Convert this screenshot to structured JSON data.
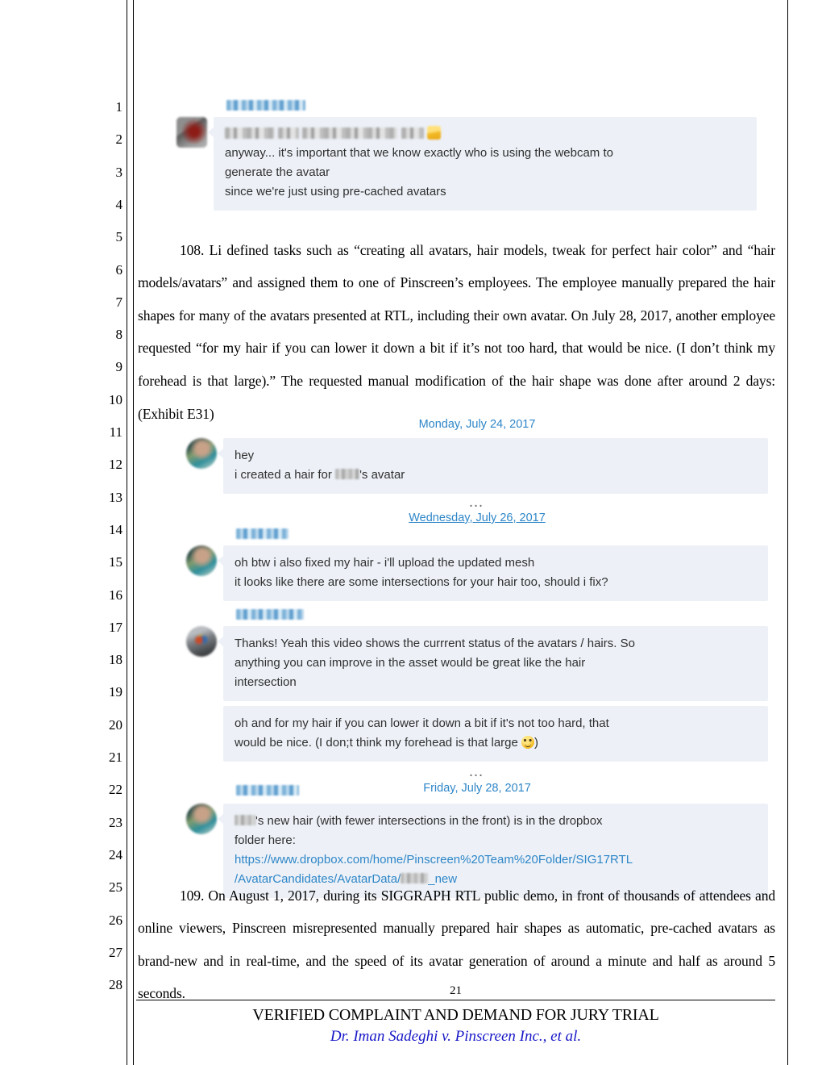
{
  "document": {
    "line_numbers": [
      "1",
      "2",
      "3",
      "4",
      "5",
      "6",
      "7",
      "8",
      "9",
      "10",
      "11",
      "12",
      "13",
      "14",
      "15",
      "16",
      "17",
      "18",
      "19",
      "20",
      "21",
      "22",
      "23",
      "24",
      "25",
      "26",
      "27",
      "28"
    ],
    "paragraphs": [
      {
        "id": "108",
        "text": "108. Li defined tasks such as “creating all avatars, hair models, tweak for perfect hair color” and “hair models/avatars” and assigned them to one of Pinscreen’s employees. The employee manually prepared the hair shapes for many of the avatars presented at RTL, including their own avatar. On July 28, 2017, another employee requested “for my hair if you can lower it down a bit if it’s not too hard, that would be nice. (I don’t think my forehead is that large).” The requested manual modification of the hair shape was done after around 2 days: (Exhibit E31)"
      },
      {
        "id": "109",
        "text": "109.     On August 1, 2017, during its SIGGRAPH RTL public demo, in front of thousands of attendees and online viewers, Pinscreen misrepresented manually prepared hair shapes as automatic, pre-cached avatars as brand-new and in real-time, and the speed of its avatar generation of around a minute and half as around 5 seconds."
      }
    ],
    "footer": {
      "page_number": "21",
      "title": "VERIFIED COMPLAINT AND DEMAND FOR JURY TRIAL",
      "caption": "Dr. Iman Sadeghi v. Pinscreen Inc., et al.",
      "caption_color": "#1818c8"
    }
  },
  "exhibit_top": {
    "sender_name_redacted": true,
    "avatar": "square-dark-red-avatar",
    "messages": [
      {
        "redacted": true,
        "has_emoji": true
      },
      {
        "text": "anyway... it's important that we know exactly who is using the webcam to"
      },
      {
        "text": "generate the avatar"
      },
      {
        "text": "since we're just using pre-cached avatars"
      }
    ]
  },
  "exhibit_e31": {
    "date_separators": {
      "monday": "Monday, July 24, 2017",
      "wednesday": "Wednesday, July 26, 2017",
      "friday": "Friday, July 28, 2017"
    },
    "date_color": "#2e86c8",
    "ellipsis": "…",
    "groups": [
      {
        "avatar": "circle-teal-avatar",
        "sender_redacted": false,
        "lines": [
          {
            "text": "hey"
          },
          {
            "pre": "i created a hair for ",
            "redacted": true,
            "post": "'s avatar"
          }
        ]
      },
      {
        "avatar": "circle-teal-avatar",
        "sender_redacted": true,
        "lines": [
          {
            "text": "oh btw i also fixed my hair - i'll upload the updated mesh"
          },
          {
            "text": "it looks like there are some intersections for your hair too, should i fix?"
          }
        ]
      },
      {
        "avatar": "circle-gray-avatar",
        "sender_redacted": true,
        "lines": [
          {
            "text": "Thanks! Yeah this video shows the currrent status of the avatars / hairs. So"
          },
          {
            "text": "anything you can improve in the asset would be great like the hair"
          },
          {
            "text": "intersection"
          }
        ]
      },
      {
        "avatar": null,
        "sender_redacted": false,
        "lines": [
          {
            "text": "oh and for my hair if you can lower it down a bit if it's not too hard, that"
          },
          {
            "pre": "would be nice. (I don;t think my forehead is that large ",
            "emoji": "smiley",
            "post": ")"
          }
        ]
      },
      {
        "avatar": "circle-teal-avatar",
        "sender_redacted": true,
        "lines": [
          {
            "redacted": true,
            "post": "'s new hair (with fewer intersections in the front) is in the dropbox"
          },
          {
            "text": "folder here:"
          },
          {
            "link": "https://www.dropbox.com/home/Pinscreen%20Team%20Folder/SIG17RTL"
          },
          {
            "link_pre": "/AvatarCandidates/AvatarData/",
            "redacted": true,
            "link_post": "_new"
          }
        ]
      }
    ]
  }
}
